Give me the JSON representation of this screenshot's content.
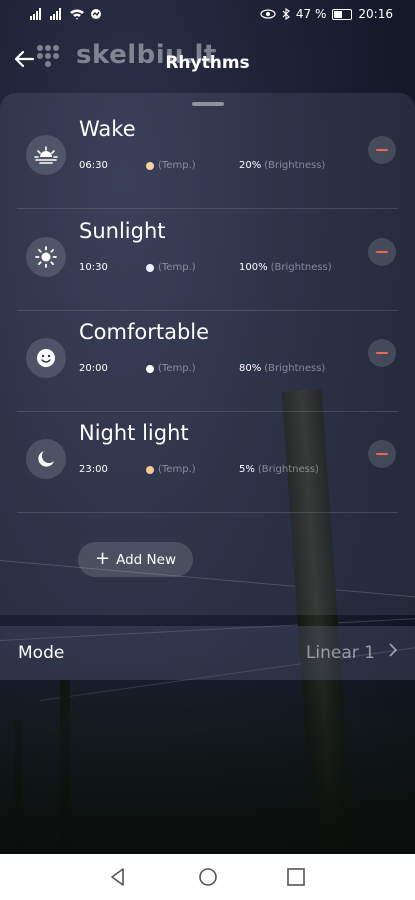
{
  "status_bar": {
    "signal_text": "▎▎▎ ▎▎▎",
    "battery_percent_text": "47 %",
    "battery_level": 0.47,
    "time": "20:16"
  },
  "header": {
    "title": "Rhythms",
    "watermark": "skelbiu.lt"
  },
  "rhythms": [
    {
      "name": "Wake",
      "time": "06:30",
      "temp_label": "(Temp.)",
      "temp_color": "#f3d2a6",
      "brightness": "20%",
      "brightness_label": "(Brightness)",
      "icon": "sunrise-icon"
    },
    {
      "name": "Sunlight",
      "time": "10:30",
      "temp_label": "(Temp.)",
      "temp_color": "#eef0ff",
      "brightness": "100%",
      "brightness_label": "(Brightness)",
      "icon": "sun-icon"
    },
    {
      "name": "Comfortable",
      "time": "20:00",
      "temp_label": "(Temp.)",
      "temp_color": "#ffffff",
      "brightness": "80%",
      "brightness_label": "(Brightness)",
      "icon": "smiley-icon"
    },
    {
      "name": "Night light",
      "time": "23:00",
      "temp_label": "(Temp.)",
      "temp_color": "#f3c796",
      "brightness": "5%",
      "brightness_label": "(Brightness)",
      "icon": "moon-icon"
    }
  ],
  "add_new": {
    "label": "Add New"
  },
  "mode": {
    "label": "Mode",
    "value": "Linear 1"
  },
  "colors": {
    "accent_remove": "#e56a58"
  }
}
